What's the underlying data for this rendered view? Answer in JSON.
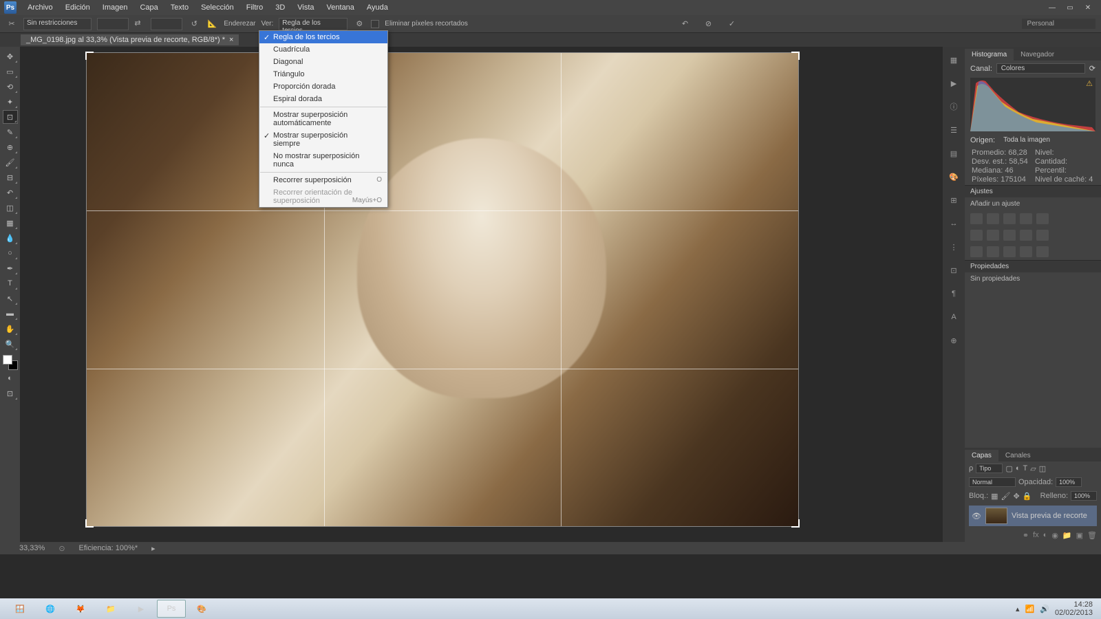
{
  "menubar": [
    "Archivo",
    "Edición",
    "Imagen",
    "Capa",
    "Texto",
    "Selección",
    "Filtro",
    "3D",
    "Vista",
    "Ventana",
    "Ayuda"
  ],
  "optbar": {
    "ratio": "Sin restricciones",
    "straighten": "Enderezar",
    "view_label": "Ver:",
    "view_value": "Regla de los tercios",
    "delete_px": "Eliminar píxeles recortados",
    "workspace": "Personal"
  },
  "doc_tab": "_MG_0198.jpg al 33,3% (Vista previa de recorte, RGB/8*) *",
  "dropdown": {
    "items1": [
      "Regla de los tercios",
      "Cuadrícula",
      "Diagonal",
      "Triángulo",
      "Proporción dorada",
      "Espiral dorada"
    ],
    "items2": [
      "Mostrar superposición automáticamente",
      "Mostrar superposición siempre",
      "No mostrar superposición nunca"
    ],
    "items3": [
      "Recorrer superposición",
      "Recorrer orientación de superposición"
    ],
    "sc1": "O",
    "sc2": "Mayús+O"
  },
  "histogram": {
    "tab1": "Histograma",
    "tab2": "Navegador",
    "canal_lbl": "Canal:",
    "canal_val": "Colores",
    "origen_lbl": "Origen:",
    "origen_val": "Toda la imagen",
    "stats": {
      "promedio_l": "Promedio:",
      "promedio_v": "68,28",
      "desv_l": "Desv. est.:",
      "desv_v": "58,54",
      "mediana_l": "Mediana:",
      "mediana_v": "46",
      "pixeles_l": "Píxeles:",
      "pixeles_v": "175104",
      "nivel_l": "Nivel:",
      "cantidad_l": "Cantidad:",
      "percentil_l": "Percentil:",
      "cache_l": "Nivel de caché:",
      "cache_v": "4"
    }
  },
  "ajustes": {
    "hdr": "Ajustes",
    "add": "Añadir un ajuste"
  },
  "props": {
    "hdr": "Propiedades",
    "none": "Sin propiedades"
  },
  "layers": {
    "tab1": "Capas",
    "tab2": "Canales",
    "kind": "Tipo",
    "blend": "Normal",
    "opac_l": "Opacidad:",
    "opac_v": "100%",
    "bloq": "Bloq.:",
    "fill_l": "Relleno:",
    "fill_v": "100%",
    "layer_name": "Vista previa de recorte"
  },
  "status": {
    "zoom": "33,33%",
    "eff": "Eficiencia: 100%*"
  },
  "taskbar": {
    "time": "14:28",
    "date": "02/02/2013"
  }
}
